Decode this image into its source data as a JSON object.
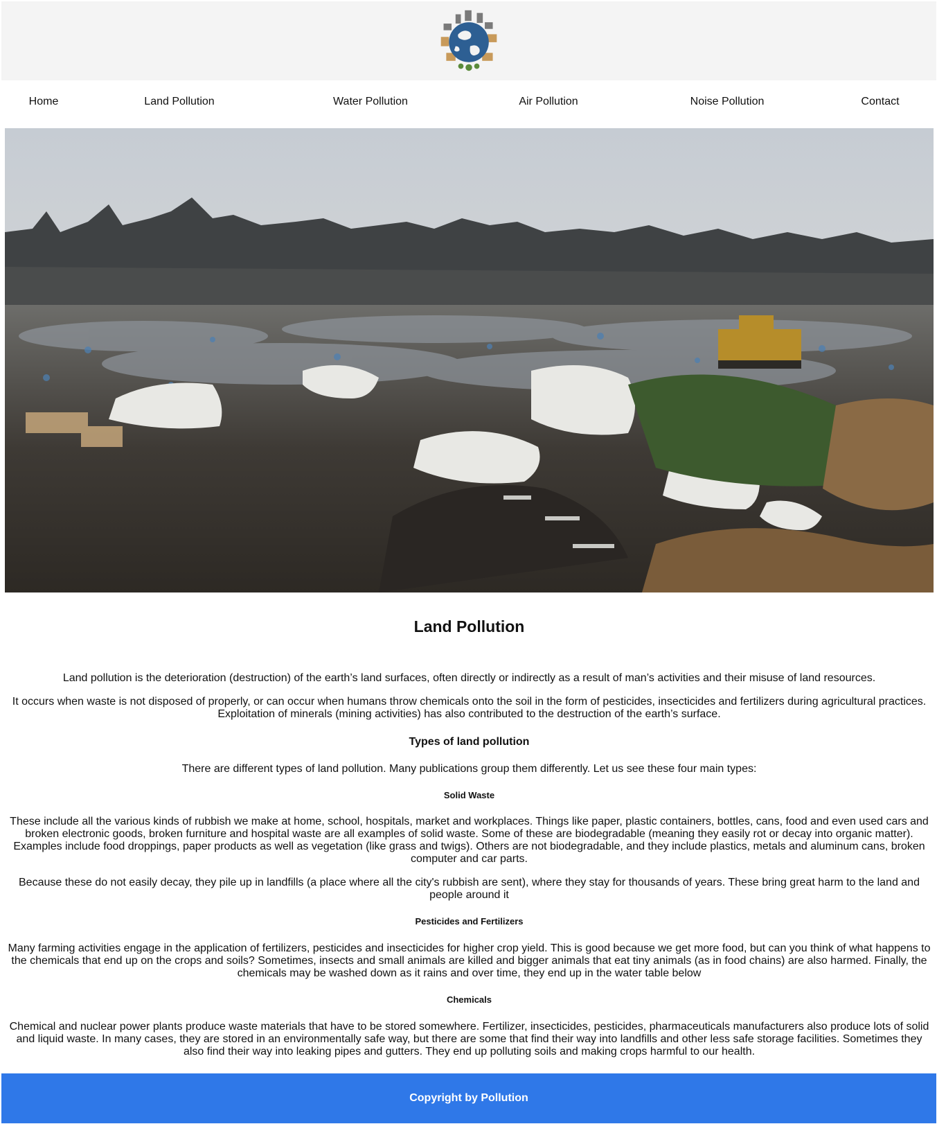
{
  "header": {
    "logo_icon": "globe-city-logo-icon"
  },
  "nav": {
    "items": [
      {
        "label": "Home"
      },
      {
        "label": "Land Pollution"
      },
      {
        "label": "Water Pollution"
      },
      {
        "label": "Air Pollution"
      },
      {
        "label": "Noise Pollution"
      },
      {
        "label": "Contact"
      }
    ]
  },
  "hero": {
    "image_subject": "landfill-photo"
  },
  "main": {
    "title": "Land Pollution",
    "intro": [
      "Land pollution is the deterioration (destruction) of the earth’s land surfaces, often directly or indirectly as a result of man’s activities and their misuse of land resources.",
      "It occurs when waste is not disposed of properly, or can occur when humans throw chemicals onto the soil in the form of pesticides, insecticides and fertilizers during agricultural practices. Exploitation of minerals (mining activities) has also contributed to the destruction of the earth’s surface."
    ],
    "types_heading": "Types of land pollution",
    "types_intro": "There are different types of land pollution. Many publications group them differently. Let us see these four main types:",
    "solid_heading": "Solid Waste",
    "solid_text": [
      "These include all the various kinds of rubbish we make at home, school, hospitals, market and workplaces. Things like paper, plastic containers, bottles, cans, food and even used cars and broken electronic goods, broken furniture and hospital waste are all examples of solid waste. Some of these are biodegradable (meaning they easily rot or decay into organic matter). Examples include food droppings, paper products as well as vegetation (like grass and twigs). Others are not biodegradable, and they include plastics, metals and aluminum cans, broken computer and car parts.",
      "Because these do not easily decay, they pile up in landfills (a place where all the city's rubbish are sent), where they stay for thousands of years. These bring great harm to the land and people around it"
    ],
    "pest_heading": "Pesticides and Fertilizers",
    "pest_text": "Many farming activities engage in the application of fertilizers, pesticides and insecticides for higher crop yield. This is good because we get more food, but can you think of what happens to the chemicals that end up on the crops and soils? Sometimes, insects and small animals are killed and bigger animals that eat tiny animals (as in food chains) are also harmed. Finally, the chemicals may be washed down as it rains and over time, they end up in the water table below",
    "chem_heading": "Chemicals",
    "chem_text": "Chemical and nuclear power plants produce waste materials that have to be stored somewhere. Fertilizer, insecticides, pesticides, pharmaceuticals manufacturers also produce lots of solid and liquid waste. In many cases, they are stored in an environmentally safe way, but there are some that find their way into landfills and other less safe storage facilities. Sometimes they also find their way into leaking pipes and gutters. They end up polluting soils and making crops harmful to our health."
  },
  "footer": {
    "copyright": "Copyright by Pollution",
    "background": "#2f78e8"
  }
}
